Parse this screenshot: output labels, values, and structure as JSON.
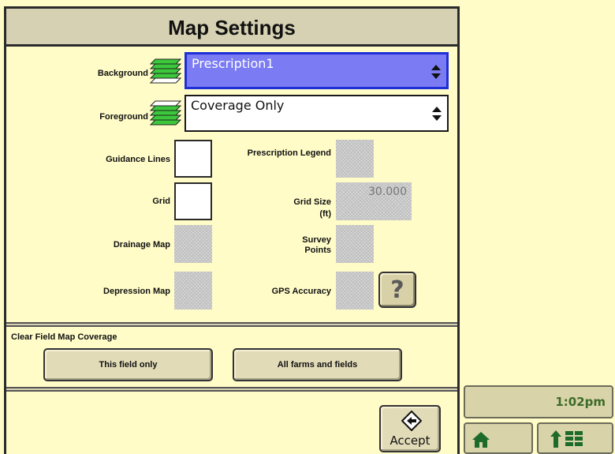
{
  "dialog": {
    "title": "Map Settings"
  },
  "layers": {
    "background_label": "Background",
    "background_value": "Prescription1",
    "foreground_label": "Foreground",
    "foreground_value": "Coverage Only"
  },
  "options": {
    "guidance_lines_label": "Guidance Lines",
    "grid_label": "Grid",
    "drainage_map_label": "Drainage Map",
    "depression_map_label": "Depression Map",
    "prescription_legend_label": "Prescription Legend",
    "grid_size_label": "Grid Size",
    "grid_size_unit": "(ft)",
    "grid_size_value": "30.000",
    "survey_points_label_1": "Survey",
    "survey_points_label_2": "Points",
    "gps_accuracy_label": "GPS Accuracy",
    "help_symbol": "?"
  },
  "clear_coverage": {
    "heading": "Clear Field Map Coverage",
    "this_field_label": "This field only",
    "all_fields_label": "All farms and fields"
  },
  "footer": {
    "accept_label": "Accept"
  },
  "status_bar": {
    "time": "1:02pm"
  },
  "icons": {
    "layers_icon": "layers-icon",
    "accept_icon": "enter-arrow-icon",
    "home_icon": "home-icon",
    "menu_icon": "up-arrow-grid-icon"
  },
  "colors": {
    "background": "#fffcc8",
    "title_bar": "#d6d1b2",
    "active_dropdown": "#7b7bf4",
    "clock_text": "#3c6b2a",
    "layer_green": "#3bc93b"
  }
}
